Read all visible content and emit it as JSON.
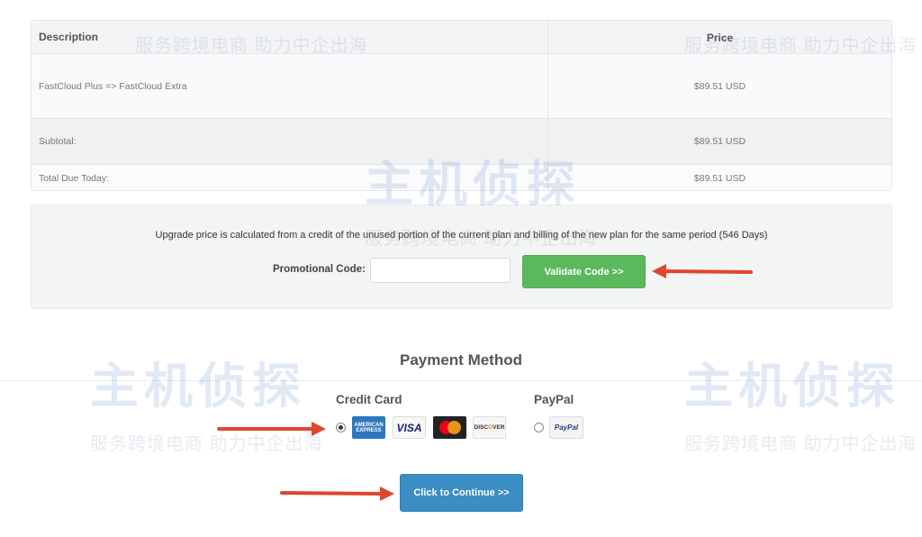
{
  "order_table": {
    "header": {
      "description": "Description",
      "price": "Price"
    },
    "rows": [
      {
        "description": "FastCloud Plus => FastCloud Extra",
        "price": "$89.51 USD"
      },
      {
        "description": "Subtotal:",
        "price": "$89.51 USD"
      },
      {
        "description": "Total Due Today:",
        "price": "$89.51 USD"
      }
    ]
  },
  "promo": {
    "note": "Upgrade price is calculated from a credit of the unused portion of the current plan and billing of the new plan for the same period (546 Days)",
    "label": "Promotional Code:",
    "input_value": "",
    "validate_label": "Validate Code >>"
  },
  "payment": {
    "title": "Payment Method",
    "credit_card_label": "Credit Card",
    "paypal_label": "PayPal",
    "selected": "credit-card",
    "cards": {
      "amex_line1": "AMERICAN",
      "amex_line2": "EXPRESS",
      "visa": "VISA",
      "discover": "DISC",
      "discover_o": "O",
      "discover_rest": "VER",
      "paypal": "PayPal"
    }
  },
  "continue_label": "Click to Continue >>",
  "watermark": {
    "brand": "主机侦探",
    "tagline": "服务跨境电商 助力中企出海"
  },
  "colors": {
    "validate_button": "#5cb85c",
    "continue_button": "#3a8ec3",
    "annotation_arrow": "#e0452f"
  }
}
